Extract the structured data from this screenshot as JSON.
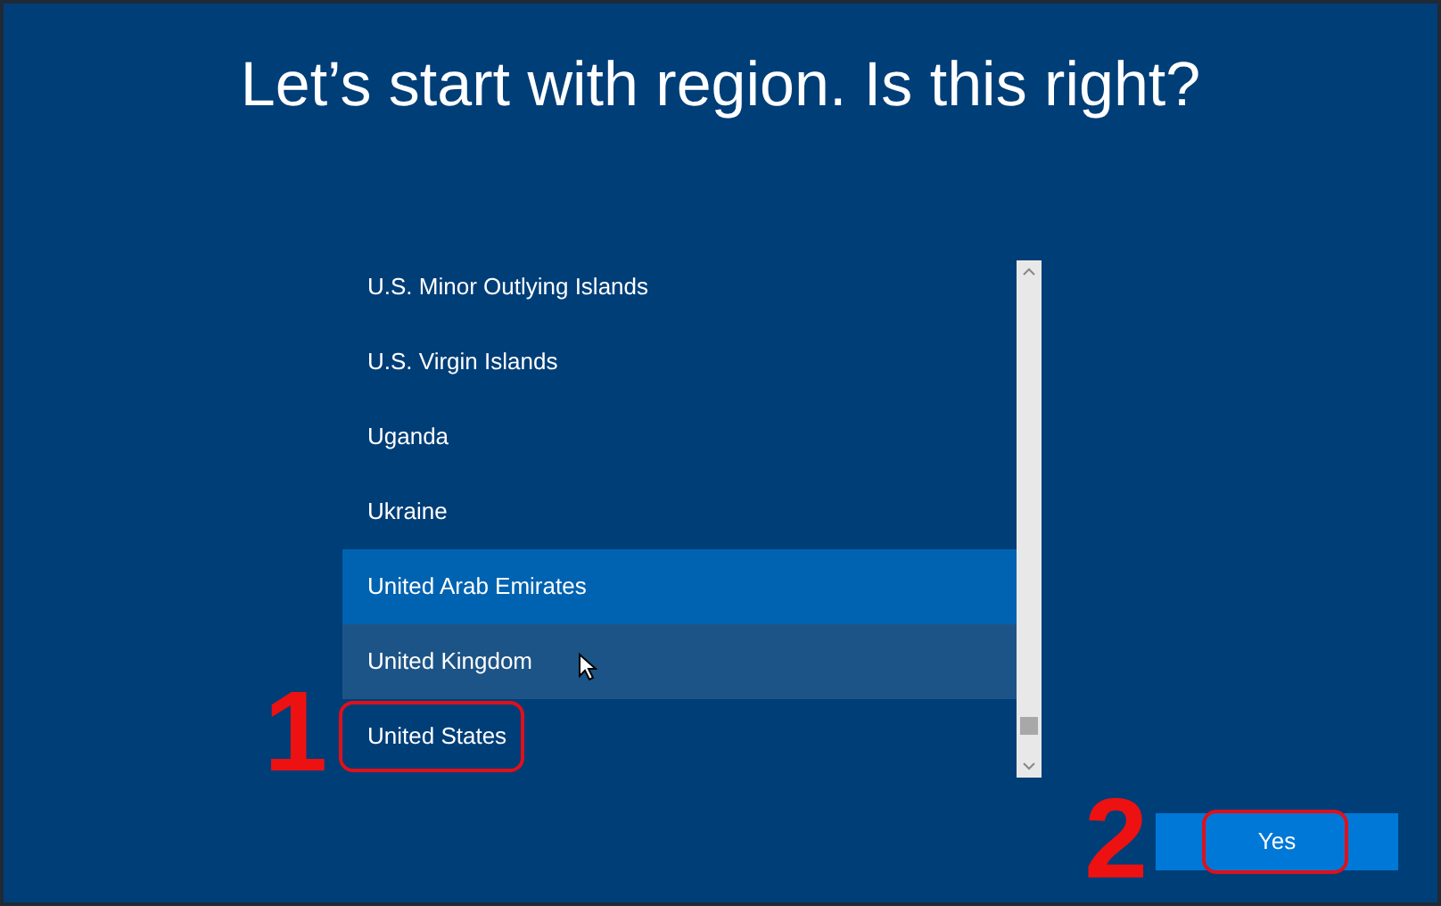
{
  "title": "Let’s start with region. Is this right?",
  "regions": [
    {
      "label": "U.S. Minor Outlying Islands",
      "selected": false,
      "hovered": false,
      "outlined": false
    },
    {
      "label": "U.S. Virgin Islands",
      "selected": false,
      "hovered": false,
      "outlined": false
    },
    {
      "label": "Uganda",
      "selected": false,
      "hovered": false,
      "outlined": false
    },
    {
      "label": "Ukraine",
      "selected": false,
      "hovered": false,
      "outlined": false
    },
    {
      "label": "United Arab Emirates",
      "selected": true,
      "hovered": false,
      "outlined": false
    },
    {
      "label": "United Kingdom",
      "selected": false,
      "hovered": true,
      "outlined": false
    },
    {
      "label": "United States",
      "selected": false,
      "hovered": false,
      "outlined": true
    }
  ],
  "yes_button": {
    "label": "Yes",
    "outlined": true
  },
  "step_markers": [
    {
      "label": "1"
    },
    {
      "label": "2"
    }
  ]
}
